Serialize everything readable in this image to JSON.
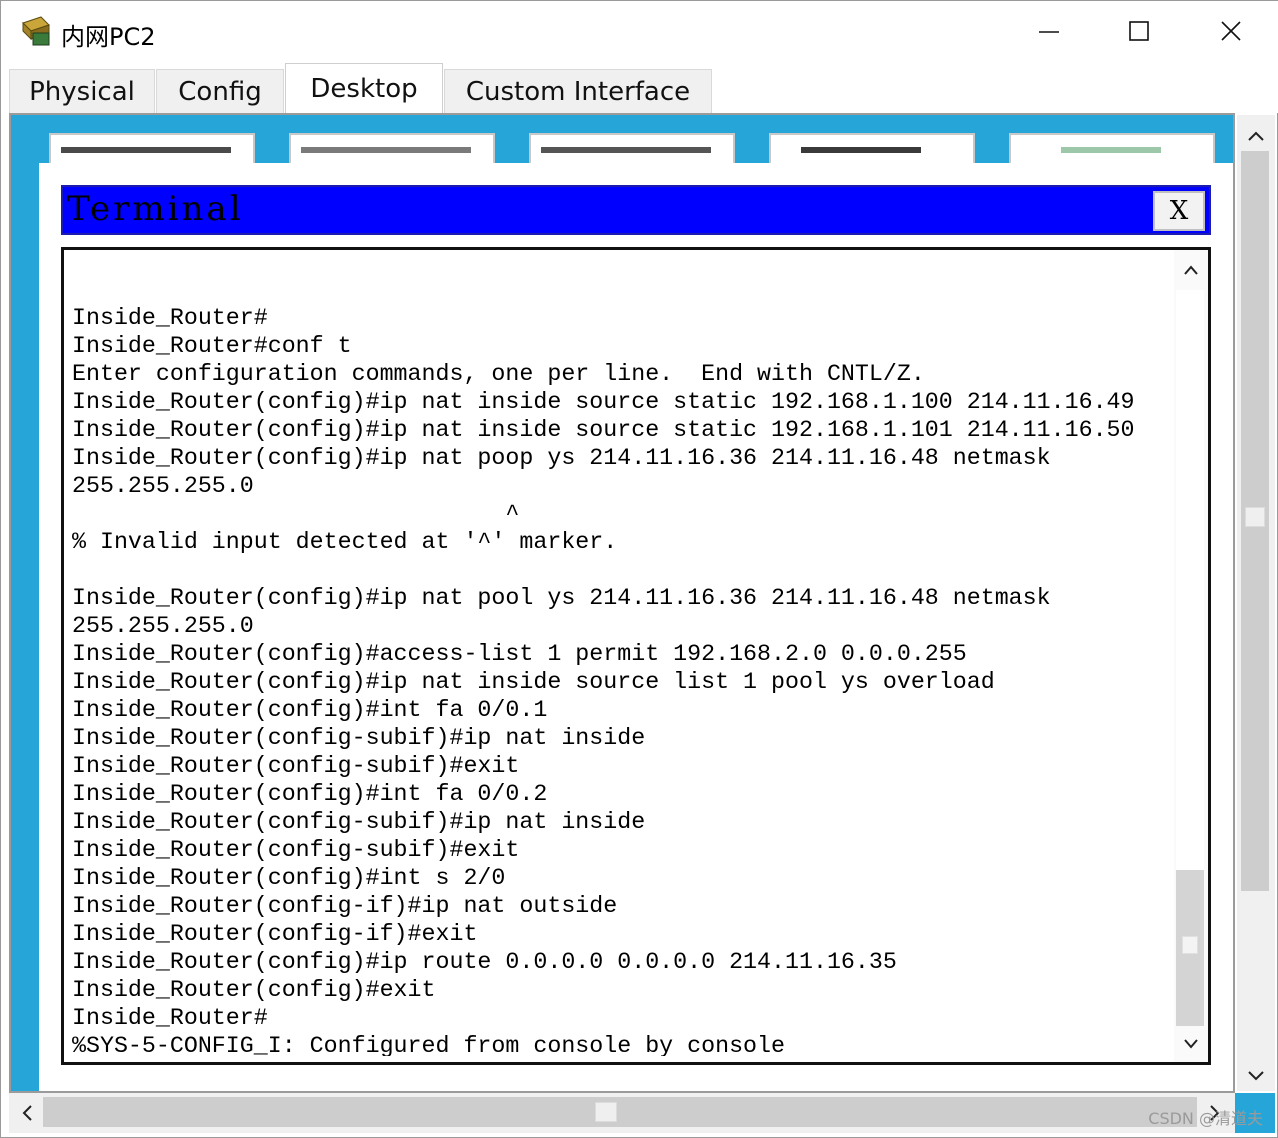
{
  "window": {
    "title": "内网PC2",
    "minimize_icon": "minimize-icon",
    "maximize_icon": "maximize-icon",
    "close_icon": "close-icon"
  },
  "tabs": [
    {
      "label": "Physical",
      "active": false
    },
    {
      "label": "Config",
      "active": false
    },
    {
      "label": "Desktop",
      "active": true
    },
    {
      "label": "Custom Interface",
      "active": false
    }
  ],
  "terminal": {
    "title": "Terminal",
    "close_label": "X",
    "lines": [
      "",
      "Inside_Router#",
      "Inside_Router#conf t",
      "Enter configuration commands, one per line.  End with CNTL/Z.",
      "Inside_Router(config)#ip nat inside source static 192.168.1.100 214.11.16.49",
      "Inside_Router(config)#ip nat inside source static 192.168.1.101 214.11.16.50",
      "Inside_Router(config)#ip nat poop ys 214.11.16.36 214.11.16.48 netmask",
      "255.255.255.0",
      "                               ^",
      "% Invalid input detected at '^' marker.",
      "",
      "Inside_Router(config)#ip nat pool ys 214.11.16.36 214.11.16.48 netmask",
      "255.255.255.0",
      "Inside_Router(config)#access-list 1 permit 192.168.2.0 0.0.0.255",
      "Inside_Router(config)#ip nat inside source list 1 pool ys overload",
      "Inside_Router(config)#int fa 0/0.1",
      "Inside_Router(config-subif)#ip nat inside",
      "Inside_Router(config-subif)#exit",
      "Inside_Router(config)#int fa 0/0.2",
      "Inside_Router(config-subif)#ip nat inside",
      "Inside_Router(config-subif)#exit",
      "Inside_Router(config)#int s 2/0",
      "Inside_Router(config-if)#ip nat outside",
      "Inside_Router(config-if)#exit",
      "Inside_Router(config)#ip route 0.0.0.0 0.0.0.0 214.11.16.35",
      "Inside_Router(config)#exit",
      "Inside_Router#",
      "%SYS-5-CONFIG_I: Configured from console by console"
    ]
  },
  "watermark": "CSDN @清道夫",
  "colors": {
    "desktop_bg": "#26a6d8",
    "terminal_titlebar": "#0000ff"
  }
}
